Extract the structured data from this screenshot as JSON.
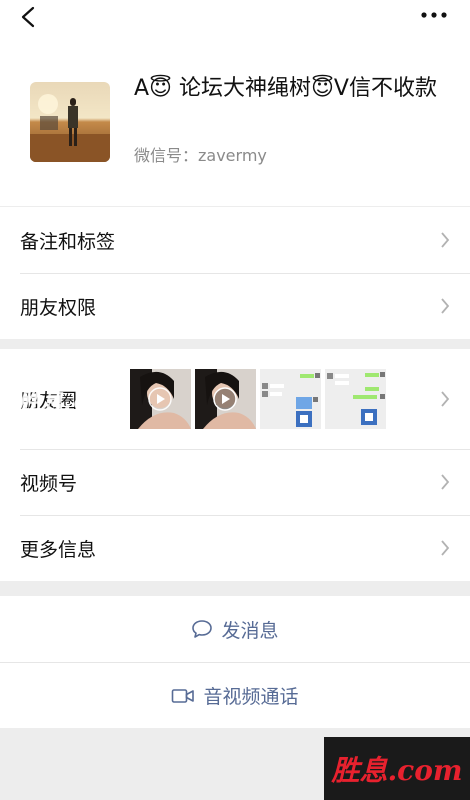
{
  "header": {
    "back_icon": "chevron-left-icon",
    "more_icon": "more-dots-icon"
  },
  "profile": {
    "name": "A😇 论坛大神绳树😇V信不收款",
    "wechat_id": "微信号：zavermy"
  },
  "rows": {
    "remark_tags": "备注和标签",
    "friend_permissions": "朋友权限",
    "moments": "朋友圈",
    "channels": "视频号",
    "more_info": "更多信息"
  },
  "actions": {
    "send_message": "发消息",
    "av_call": "音视频通话"
  },
  "watermark": {
    "text": "胜息.com",
    "box_text": "胜息.com"
  },
  "colors": {
    "link": "#576b95",
    "background": "#ededed",
    "watermark": "#e8212e"
  }
}
